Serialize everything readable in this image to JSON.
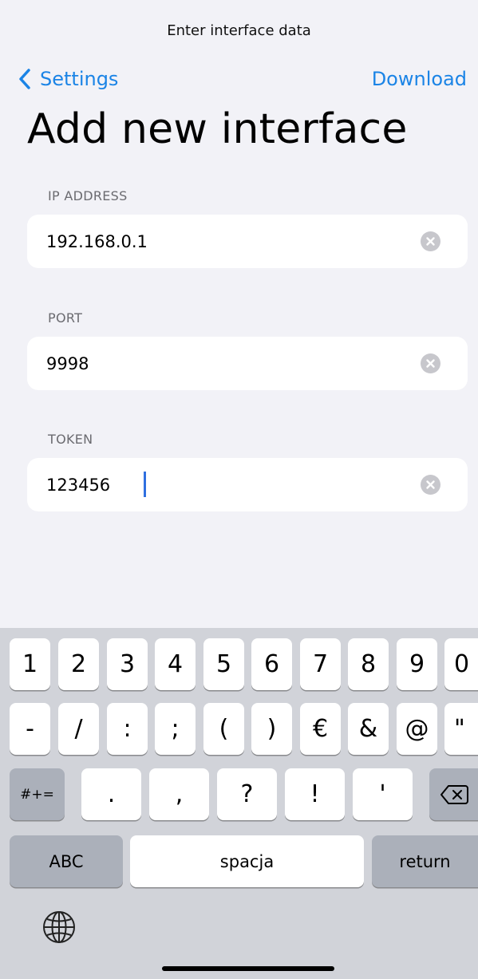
{
  "nav": {
    "title": "Enter interface data",
    "back_label": "Settings",
    "action_label": "Download"
  },
  "page_title": "Add new interface",
  "fields": [
    {
      "label": "IP ADDRESS",
      "value": "192.168.0.1"
    },
    {
      "label": "PORT",
      "value": "9998"
    },
    {
      "label": "TOKEN",
      "value": "123456"
    }
  ],
  "keyboard": {
    "row1": [
      "1",
      "2",
      "3",
      "4",
      "5",
      "6",
      "7",
      "8",
      "9",
      "0"
    ],
    "row2": [
      "-",
      "/",
      ":",
      ";",
      "(",
      ")",
      "€",
      "&",
      "@",
      "\""
    ],
    "row3_shift": "#+=",
    "row3": [
      ".",
      ",",
      "?",
      "!",
      "'"
    ],
    "abc": "ABC",
    "space": "spacja",
    "return": "return"
  },
  "icons": {
    "back": "chevron-left-icon",
    "clear": "clear-circle-icon",
    "delete": "backspace-icon",
    "globe": "globe-icon"
  },
  "colors": {
    "accent": "#1b84e6",
    "background": "#f2f2f7",
    "cursor": "#2f6fe0"
  }
}
